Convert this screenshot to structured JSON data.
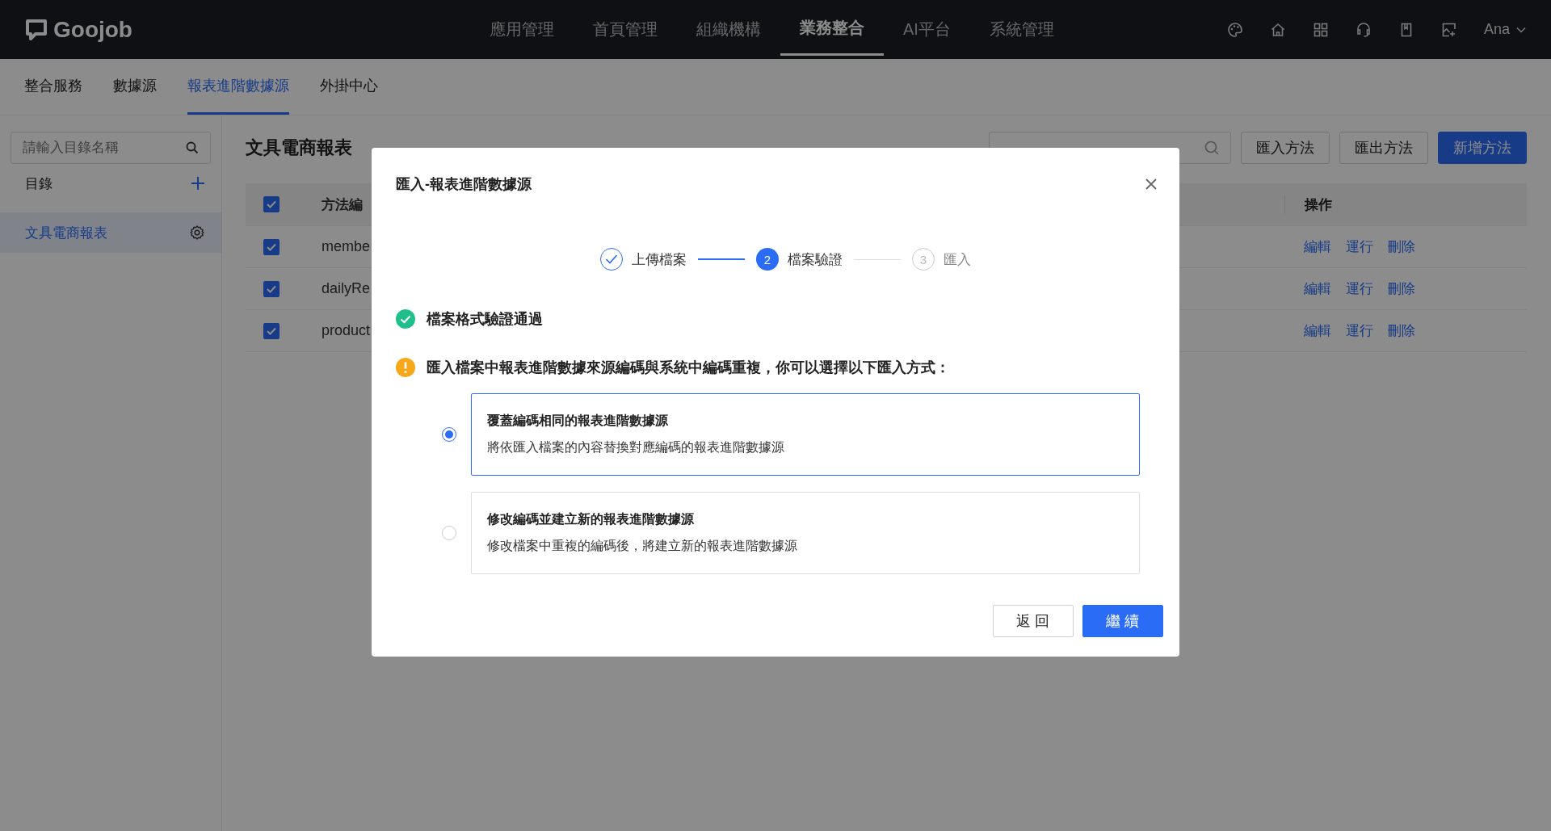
{
  "top_nav": {
    "logo": "Goojob",
    "items": [
      {
        "label": "應用管理",
        "selected": false
      },
      {
        "label": "首頁管理",
        "selected": false
      },
      {
        "label": "組織機構",
        "selected": false
      },
      {
        "label": "業務整合",
        "selected": true
      },
      {
        "label": "AI平台",
        "selected": false
      },
      {
        "label": "系統管理",
        "selected": false
      }
    ],
    "user": "Ana"
  },
  "sub_nav": [
    {
      "label": "整合服務",
      "selected": false
    },
    {
      "label": "數據源",
      "selected": false
    },
    {
      "label": "報表進階數據源",
      "selected": true
    },
    {
      "label": "外掛中心",
      "selected": false
    }
  ],
  "sidebar": {
    "search": {
      "placeholder": "請輸入目錄名稱"
    },
    "heading": "目錄",
    "items": [
      {
        "label": "文具電商報表",
        "selected": true
      }
    ]
  },
  "main": {
    "title": "文具電商報表",
    "buttons": [
      {
        "label": "匯入方法",
        "primary": false
      },
      {
        "label": "匯出方法",
        "primary": false
      },
      {
        "label": "新增方法",
        "primary": true
      }
    ],
    "table": {
      "header_checked": true,
      "columns": [
        "方法編",
        "操作"
      ],
      "rows": [
        {
          "checked": true,
          "code": "membe",
          "actions": [
            "編輯",
            "運行",
            "刪除"
          ]
        },
        {
          "checked": true,
          "code": "dailyRe",
          "actions": [
            "編輯",
            "運行",
            "刪除"
          ]
        },
        {
          "checked": true,
          "code": "product",
          "actions": [
            "編輯",
            "運行",
            "刪除"
          ]
        }
      ]
    }
  },
  "dialog": {
    "title": "匯入-報表進階數據源",
    "steps": [
      {
        "label": "上傳檔案",
        "kind": "done"
      },
      {
        "number": "2",
        "label": "檔案驗證",
        "kind": "current"
      },
      {
        "number": "3",
        "label": "匯入",
        "kind": "pending"
      }
    ],
    "messages": [
      {
        "kind": "success",
        "text": "檔案格式驗證通過"
      },
      {
        "kind": "warning",
        "text": "匯入檔案中報表進階數據來源編碼與系統中編碼重複，你可以選擇以下匯入方式："
      }
    ],
    "options": [
      {
        "title": "覆蓋編碼相同的報表進階數據源",
        "description": "將依匯入檔案的內容替換對應編碼的報表進階數據源",
        "selected": true
      },
      {
        "title": "修改編碼並建立新的報表進階數據源",
        "description": "修改檔案中重複的編碼後，將建立新的報表進階數據源",
        "selected": false
      }
    ],
    "buttons": [
      {
        "label": "返 回",
        "primary": false
      },
      {
        "label": "繼 續",
        "primary": true
      }
    ]
  }
}
